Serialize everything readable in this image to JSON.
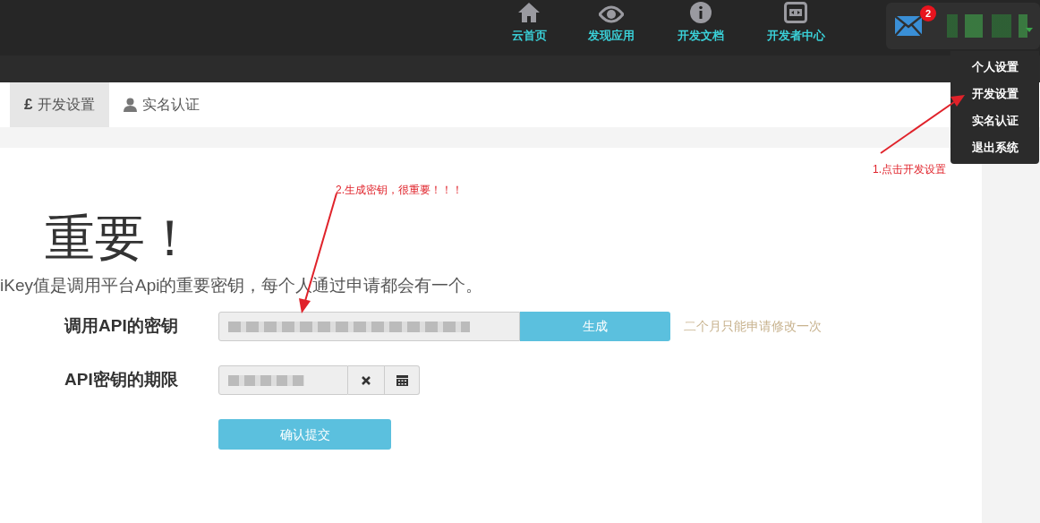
{
  "nav": {
    "items": [
      {
        "label": "云首页"
      },
      {
        "label": "发现应用"
      },
      {
        "label": "开发文档"
      },
      {
        "label": "开发者中心"
      }
    ],
    "mail_badge": "2",
    "user_menu": [
      "个人设置",
      "开发设置",
      "实名认证",
      "退出系统"
    ]
  },
  "tabs": [
    {
      "label": "开发设置",
      "symbol": "£",
      "selected": true
    },
    {
      "label": "实名认证",
      "selected": false
    }
  ],
  "heading": "重要！",
  "description": "iKey值是调用平台Api的重要密钥，每个人通过申请都会有一个。",
  "form": {
    "rows": [
      {
        "kind": "key",
        "label": "调用API的密钥",
        "button": "生成",
        "hint": "二个月只能申请修改一次"
      },
      {
        "kind": "date",
        "label": "API密钥的期限"
      }
    ],
    "submit": "确认提交"
  },
  "annotations": [
    {
      "text": "1.点击开发设置"
    },
    {
      "text": "2.生成密钥，很重要！！！"
    }
  ]
}
